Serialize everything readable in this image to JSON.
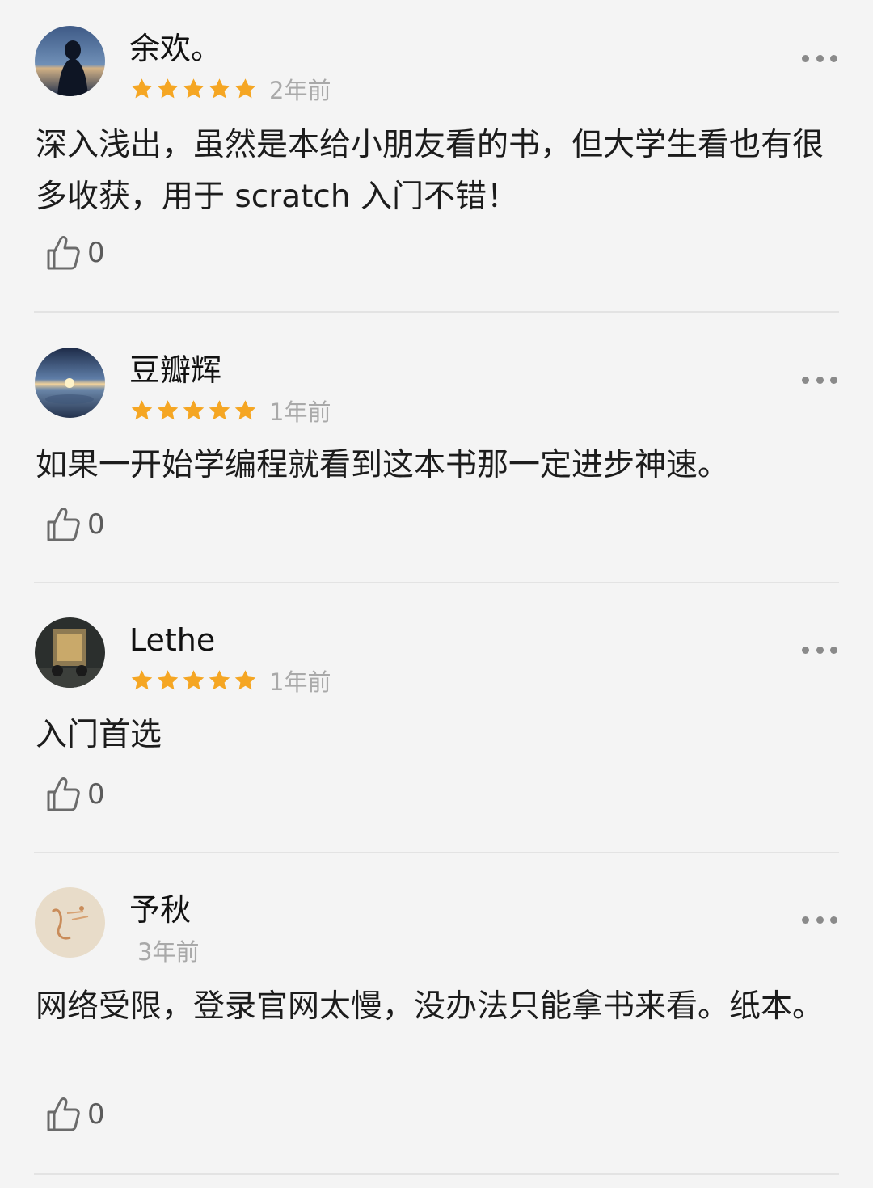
{
  "reviews": [
    {
      "username": "余欢。",
      "rating": 5,
      "time": "2年前",
      "content": "深入浅出，虽然是本给小朋友看的书，但大学生看也有很多收获，用于 scratch 入门不错！",
      "likes": "0"
    },
    {
      "username": "豆瓣辉",
      "rating": 5,
      "time": "1年前",
      "content": "如果一开始学编程就看到这本书那一定进步神速。",
      "likes": "0"
    },
    {
      "username": "Lethe",
      "rating": 5,
      "time": "1年前",
      "content": "入门首选",
      "likes": "0"
    },
    {
      "username": "予秋",
      "rating": 0,
      "time": "3年前",
      "content": "网络受限，登录官网太慢，没办法只能拿书来看。纸本。",
      "likes": "0"
    }
  ],
  "colors": {
    "star": "#f5a623",
    "background": "#f4f4f4",
    "time": "#a9a9a9"
  }
}
